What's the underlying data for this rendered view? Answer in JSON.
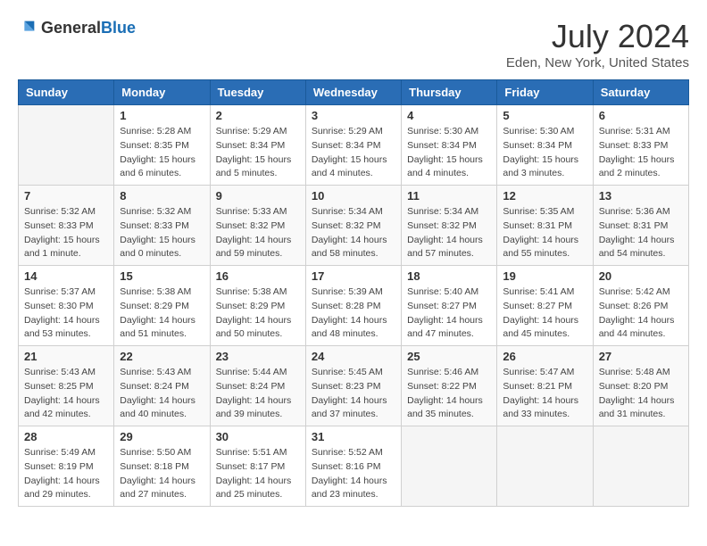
{
  "header": {
    "logo_general": "General",
    "logo_blue": "Blue",
    "title": "July 2024",
    "subtitle": "Eden, New York, United States"
  },
  "weekdays": [
    "Sunday",
    "Monday",
    "Tuesday",
    "Wednesday",
    "Thursday",
    "Friday",
    "Saturday"
  ],
  "weeks": [
    [
      {
        "day": "",
        "info": ""
      },
      {
        "day": "1",
        "info": "Sunrise: 5:28 AM\nSunset: 8:35 PM\nDaylight: 15 hours\nand 6 minutes."
      },
      {
        "day": "2",
        "info": "Sunrise: 5:29 AM\nSunset: 8:34 PM\nDaylight: 15 hours\nand 5 minutes."
      },
      {
        "day": "3",
        "info": "Sunrise: 5:29 AM\nSunset: 8:34 PM\nDaylight: 15 hours\nand 4 minutes."
      },
      {
        "day": "4",
        "info": "Sunrise: 5:30 AM\nSunset: 8:34 PM\nDaylight: 15 hours\nand 4 minutes."
      },
      {
        "day": "5",
        "info": "Sunrise: 5:30 AM\nSunset: 8:34 PM\nDaylight: 15 hours\nand 3 minutes."
      },
      {
        "day": "6",
        "info": "Sunrise: 5:31 AM\nSunset: 8:33 PM\nDaylight: 15 hours\nand 2 minutes."
      }
    ],
    [
      {
        "day": "7",
        "info": "Sunrise: 5:32 AM\nSunset: 8:33 PM\nDaylight: 15 hours\nand 1 minute."
      },
      {
        "day": "8",
        "info": "Sunrise: 5:32 AM\nSunset: 8:33 PM\nDaylight: 15 hours\nand 0 minutes."
      },
      {
        "day": "9",
        "info": "Sunrise: 5:33 AM\nSunset: 8:32 PM\nDaylight: 14 hours\nand 59 minutes."
      },
      {
        "day": "10",
        "info": "Sunrise: 5:34 AM\nSunset: 8:32 PM\nDaylight: 14 hours\nand 58 minutes."
      },
      {
        "day": "11",
        "info": "Sunrise: 5:34 AM\nSunset: 8:32 PM\nDaylight: 14 hours\nand 57 minutes."
      },
      {
        "day": "12",
        "info": "Sunrise: 5:35 AM\nSunset: 8:31 PM\nDaylight: 14 hours\nand 55 minutes."
      },
      {
        "day": "13",
        "info": "Sunrise: 5:36 AM\nSunset: 8:31 PM\nDaylight: 14 hours\nand 54 minutes."
      }
    ],
    [
      {
        "day": "14",
        "info": "Sunrise: 5:37 AM\nSunset: 8:30 PM\nDaylight: 14 hours\nand 53 minutes."
      },
      {
        "day": "15",
        "info": "Sunrise: 5:38 AM\nSunset: 8:29 PM\nDaylight: 14 hours\nand 51 minutes."
      },
      {
        "day": "16",
        "info": "Sunrise: 5:38 AM\nSunset: 8:29 PM\nDaylight: 14 hours\nand 50 minutes."
      },
      {
        "day": "17",
        "info": "Sunrise: 5:39 AM\nSunset: 8:28 PM\nDaylight: 14 hours\nand 48 minutes."
      },
      {
        "day": "18",
        "info": "Sunrise: 5:40 AM\nSunset: 8:27 PM\nDaylight: 14 hours\nand 47 minutes."
      },
      {
        "day": "19",
        "info": "Sunrise: 5:41 AM\nSunset: 8:27 PM\nDaylight: 14 hours\nand 45 minutes."
      },
      {
        "day": "20",
        "info": "Sunrise: 5:42 AM\nSunset: 8:26 PM\nDaylight: 14 hours\nand 44 minutes."
      }
    ],
    [
      {
        "day": "21",
        "info": "Sunrise: 5:43 AM\nSunset: 8:25 PM\nDaylight: 14 hours\nand 42 minutes."
      },
      {
        "day": "22",
        "info": "Sunrise: 5:43 AM\nSunset: 8:24 PM\nDaylight: 14 hours\nand 40 minutes."
      },
      {
        "day": "23",
        "info": "Sunrise: 5:44 AM\nSunset: 8:24 PM\nDaylight: 14 hours\nand 39 minutes."
      },
      {
        "day": "24",
        "info": "Sunrise: 5:45 AM\nSunset: 8:23 PM\nDaylight: 14 hours\nand 37 minutes."
      },
      {
        "day": "25",
        "info": "Sunrise: 5:46 AM\nSunset: 8:22 PM\nDaylight: 14 hours\nand 35 minutes."
      },
      {
        "day": "26",
        "info": "Sunrise: 5:47 AM\nSunset: 8:21 PM\nDaylight: 14 hours\nand 33 minutes."
      },
      {
        "day": "27",
        "info": "Sunrise: 5:48 AM\nSunset: 8:20 PM\nDaylight: 14 hours\nand 31 minutes."
      }
    ],
    [
      {
        "day": "28",
        "info": "Sunrise: 5:49 AM\nSunset: 8:19 PM\nDaylight: 14 hours\nand 29 minutes."
      },
      {
        "day": "29",
        "info": "Sunrise: 5:50 AM\nSunset: 8:18 PM\nDaylight: 14 hours\nand 27 minutes."
      },
      {
        "day": "30",
        "info": "Sunrise: 5:51 AM\nSunset: 8:17 PM\nDaylight: 14 hours\nand 25 minutes."
      },
      {
        "day": "31",
        "info": "Sunrise: 5:52 AM\nSunset: 8:16 PM\nDaylight: 14 hours\nand 23 minutes."
      },
      {
        "day": "",
        "info": ""
      },
      {
        "day": "",
        "info": ""
      },
      {
        "day": "",
        "info": ""
      }
    ]
  ]
}
